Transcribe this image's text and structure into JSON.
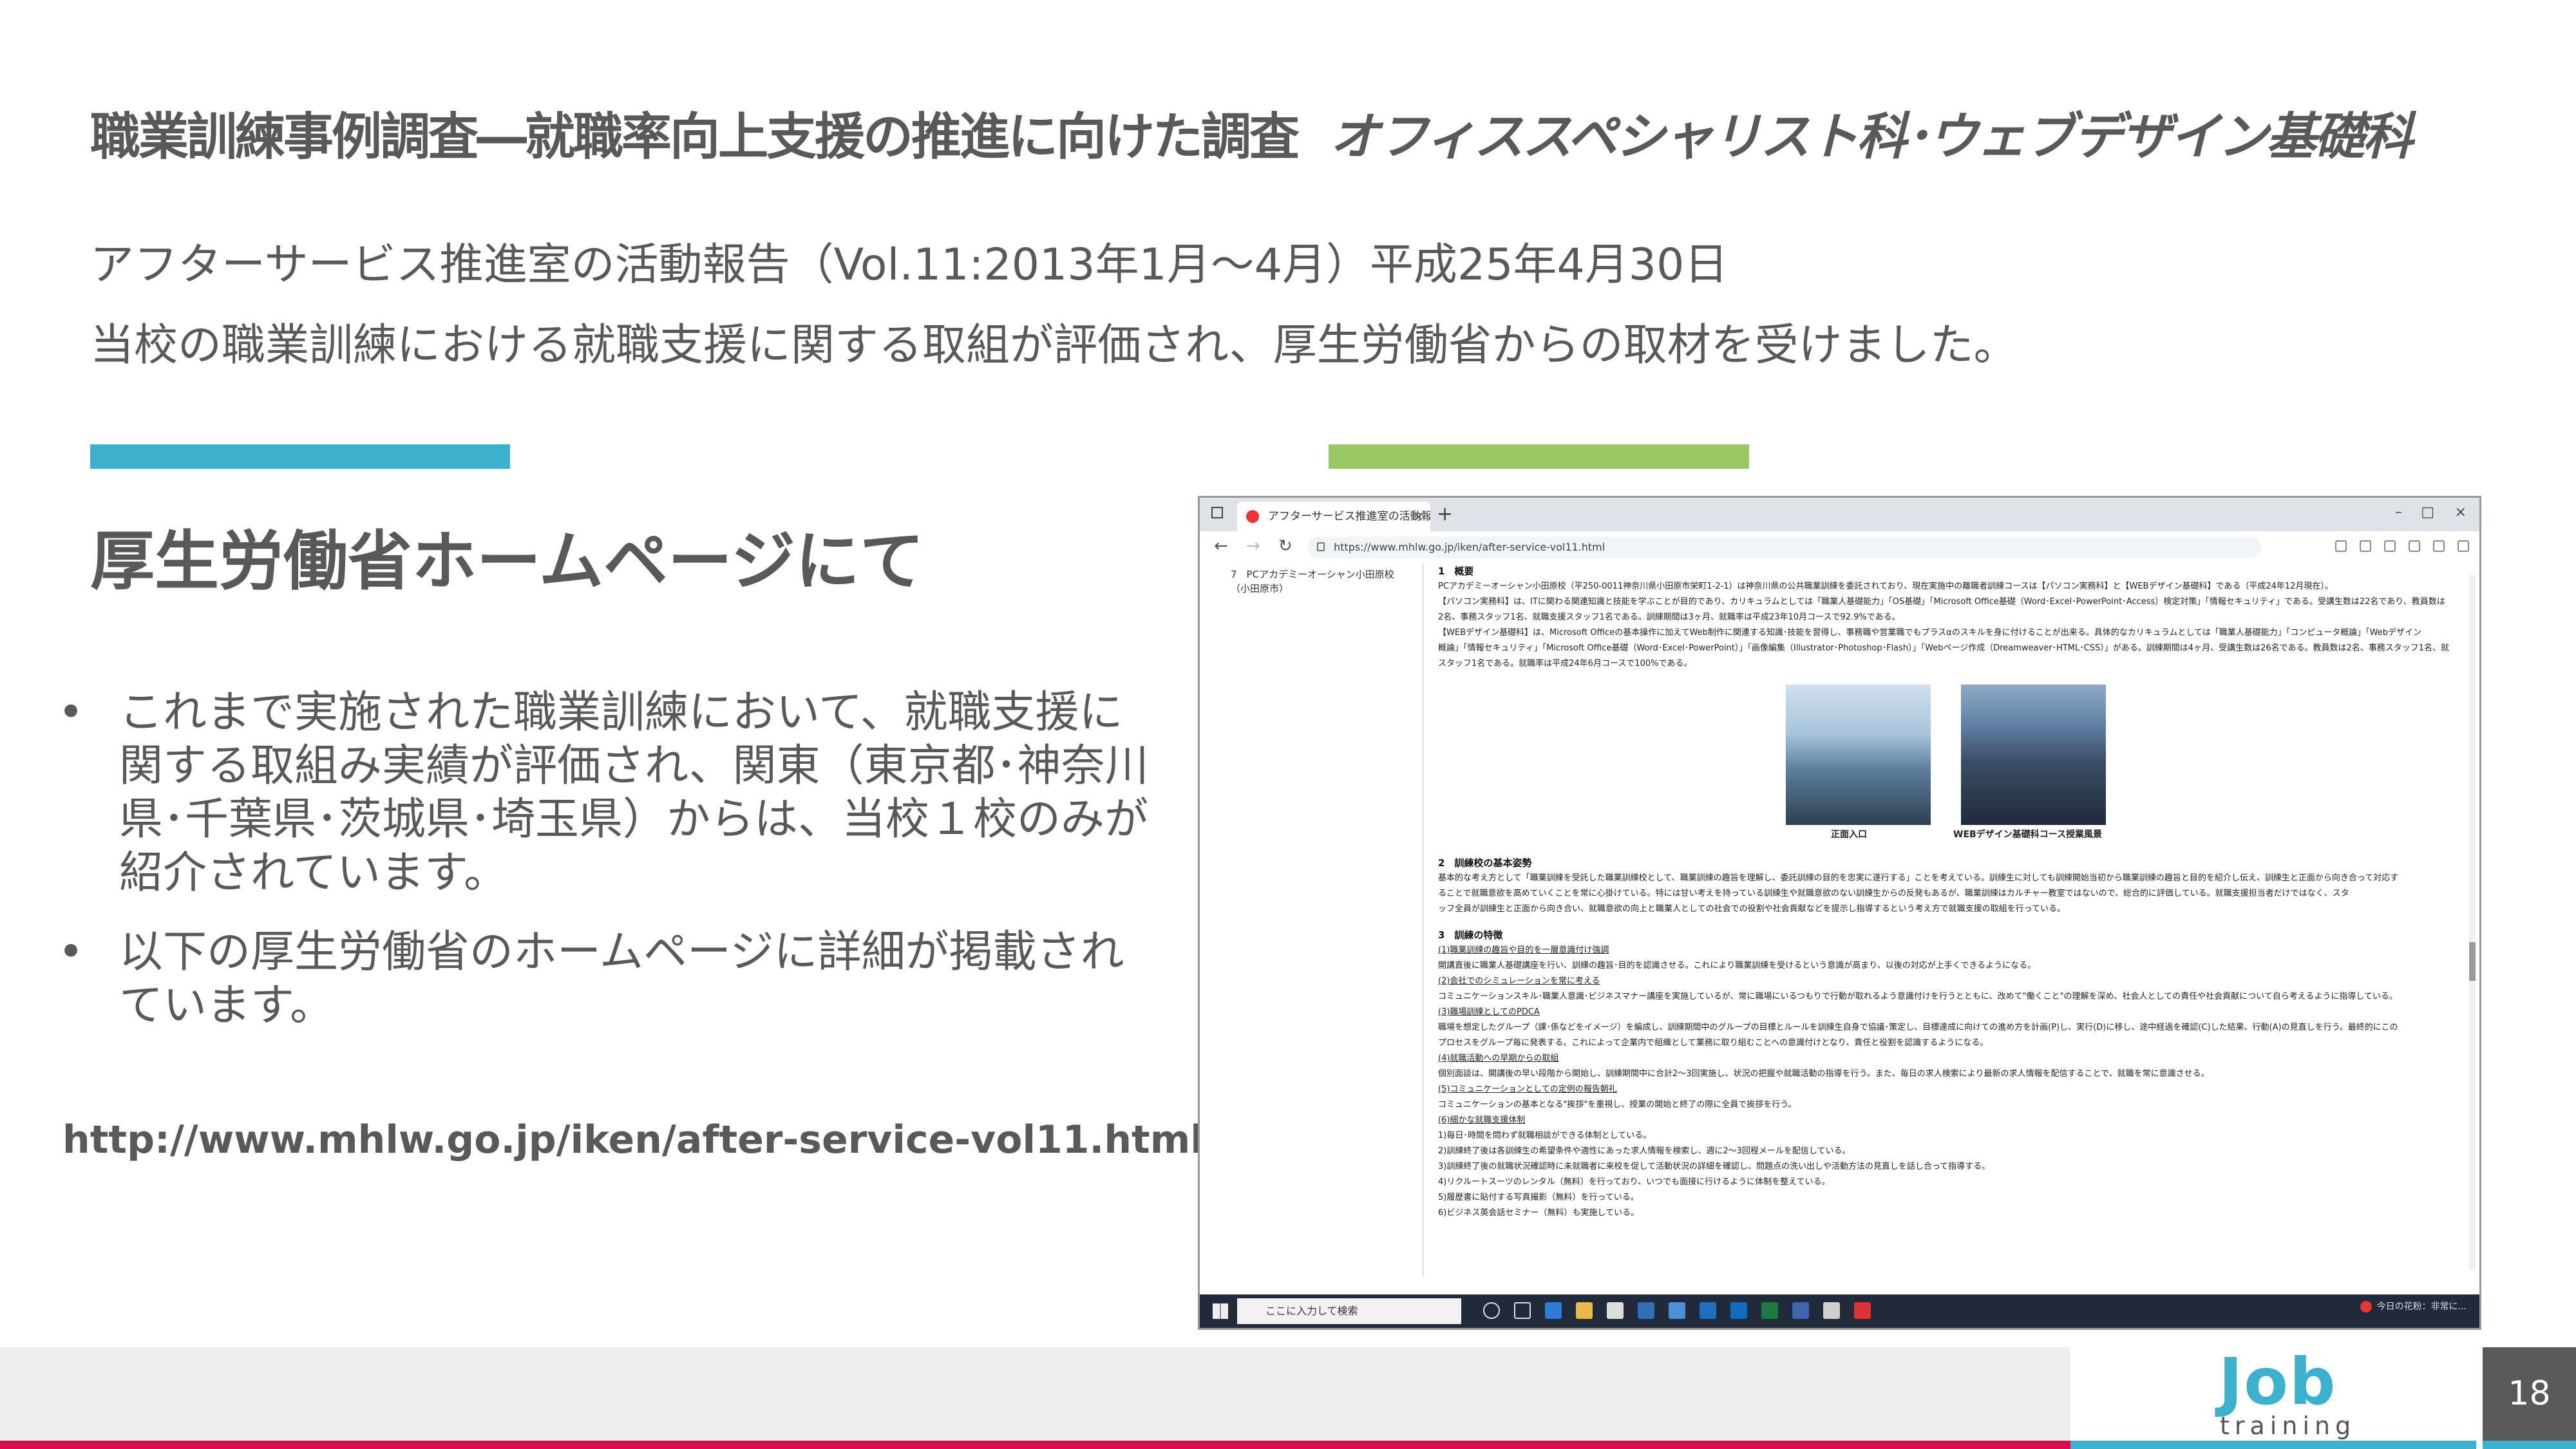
{
  "slide": {
    "title_main": "職業訓練事例調査―就職率向上支援の推進に向けた調査",
    "title_sub": "オフィススペシャリスト科･ウェブデザイン基礎科",
    "intro_line1": "アフターサービス推進室の活動報告（Vol.11:2013年1月～4月）平成25年4月30日",
    "intro_line2": "当校の職業訓練における就職支援に関する取組が評価され、厚生労働省からの取材を受けました。",
    "heading": "厚生労働省ホームページにて",
    "bullets": [
      "これまで実施された職業訓練において、就職支援に関する取組み実績が評価され、関東（東京都･神奈川県･千葉県･茨城県･埼玉県）からは、当校１校のみが紹介されています。",
      "以下の厚生労働省のホームページに詳細が掲載されています。"
    ],
    "bullet_marker": "•",
    "url": "http://www.mhlw.go.jp/iken/after-service-vol11.html",
    "accent_blue": "#3cb0cc",
    "accent_green": "#9bc963",
    "accent_red": "#d6104f"
  },
  "browser": {
    "tab_title": "アフターサービス推進室の活動報告",
    "tab_close": "×",
    "new_tab": "+",
    "window_controls": [
      "–",
      "□",
      "×"
    ],
    "nav_back": "←",
    "nav_forward": "→",
    "nav_reload": "↻",
    "address": "https://www.mhlw.go.jp/iken/after-service-vol11.html",
    "left_col": [
      "7　PCアカデミーオーシャン小田原校",
      "（小田原市）"
    ],
    "sections": [
      {
        "title": "1　概要",
        "lines": [
          "PCアカデミーオーシャン小田原校（平250-0011神奈川県小田原市栄町1-2-1）は神奈川県の公共職業訓練を委託されており、現在実施中の離職者訓練コースは【パソコン実務科】と【WEBデザイン基礎科】である（平成24年12月現在）。",
          "【パソコン実務科】は、ITに関わる関連知識と技能を学ぶことが目的であり、カリキュラムとしては「職業人基礎能力」「OS基礎」「Microsoft Office基礎（Word･Excel･PowerPoint･Access）検定対策」「情報セキュリティ」である。受講生数は22名であり、教員数は",
          "2名、事務スタッフ1名、就職支援スタッフ1名である。訓練期間は3ヶ月、就職率は平成23年10月コースで92.9%である。",
          "【WEBデザイン基礎科】は、Microsoft Officeの基本操作に加えてWeb制作に関連する知識･技能を習得し、事務職や営業職でもプラスαのスキルを身に付けることが出来る。具体的なカリキュラムとしては「職業人基礎能力」「コンピュータ概論」「Webデザイン",
          "概論」「情報セキュリティ」「Microsoft Office基礎（Word･Excel･PowerPoint）」「画像編集（Illustrator･Photoshop･Flash）」「Webページ作成（Dreamweaver･HTML･CSS）」がある。訓練期間は4ヶ月、受講生数は26名である。教員数は2名、事務スタッフ1名、就職支援",
          "スタッフ1名である。就職率は平成24年6月コースで100%である。"
        ]
      },
      {
        "title": "2　訓練校の基本姿勢",
        "lines": [
          "基本的な考え方として「職業訓練を受託した職業訓練校として、職業訓練の趣旨を理解し、委託訓練の目的を忠実に遂行する」ことを考えている。訓練生に対しても訓練開始当初から職業訓練の趣旨と目的を紹介し伝え、訓練生と正面から向き合って対応す",
          "ることで就職意欲を高めていくことを常に心掛けている。特には甘い考えを持っている訓練生や就職意欲のない訓練生からの反発もあるが、職業訓練はカルチャー教室ではないので、総合的に評価している。就職支援担当者だけではなく、スタ",
          "ッフ全員が訓練生と正面から向き合い、就職意欲の向上と職業人としての社会での役割や社会貢献などを提示し指導するという考え方で就職支援の取組を行っている。"
        ]
      },
      {
        "title": "3　訓練の特徴",
        "lines": [
          "(1)職業訓練の趣旨や目的を一層意識付け強調",
          "開講直後に職業人基礎講座を行い、訓練の趣旨･目的を認識させる。これにより職業訓練を受けるという意識が高まり、以後の対応が上手くできるようになる。",
          "(2)会社でのシミュレーションを常に考える",
          "コミュニケーションスキル･職業人意識･ビジネスマナー講座を実施しているが、常に職場にいるつもりで行動が取れるよう意識付けを行うとともに、改めて\"働くこと\"の理解を深め、社会人としての責任や社会貢献について自ら考えるように指導している。",
          "(3)職場訓練としてのPDCA",
          "職場を想定したグループ（課･係などをイメージ）を編成し、訓練期間中のグループの目標とルールを訓練生自身で協議･策定し、目標達成に向けての進め方を計画(P)し、実行(D)に移し、途中経過を確認(C)した結果、行動(A)の見直しを行う。最終的にこの",
          "プロセスをグループ毎に発表する。これによって企業内で組織として業務に取り組むことへの意識付けとなり、責任と役割を認識するようになる。",
          "(4)就職活動への早期からの取組",
          "個別面談は、開講後の早い段階から開始し、訓練期間中に合計2～3回実施し、状況の把握や就職活動の指導を行う。また、毎日の求人検索により最新の求人情報を配信することで、就職を常に意識させる。",
          "(5)コミュニケーションとしての定例の報告朝礼",
          "コミュニケーションの基本となる\"挨拶\"を重視し、授業の開始と終了の際に全員で挨拶を行う。",
          "(6)細かな就職支援体制",
          "1)毎日･時間を問わず就職相談ができる体制としている。",
          "2)訓練終了後は各訓練生の希望条件や適性にあった求人情報を検索し、週に2～3回程メールを配信している。",
          "3)訓練終了後の就職状況確認時に未就職者に来校を促して活動状況の詳細を確認し、問題点の洗い出しや活動方法の見直しを話し合って指導する。",
          "4)リクルートスーツのレンタル（無料）を行っており、いつでも面接に行けるように体制を整えている。",
          "5)履歴書に貼付する写真撮影（無料）を行っている。",
          "6)ビジネス英会話セミナー（無料）も実施している。"
        ]
      }
    ],
    "photo_captions": [
      "正面入口",
      "WEBデザイン基礎科コース授業風景"
    ],
    "taskbar_search": "ここに入力して検索",
    "tray_text": "今日の花粉：非常に..."
  },
  "footer": {
    "logo_main": "Job",
    "logo_sub": "training",
    "page_number": "18"
  }
}
